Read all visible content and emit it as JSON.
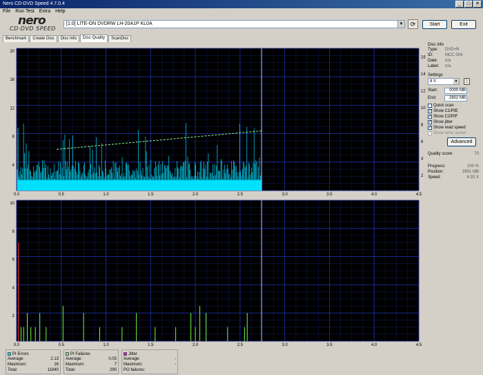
{
  "window": {
    "title": "Nero CD-DVD Speed 4.7.0.4"
  },
  "menu": [
    "File",
    "Run Test",
    "Extra",
    "Help"
  ],
  "logo": {
    "brand": "nero",
    "product": "CD·DVD SPEED"
  },
  "drive": {
    "label": "[1:0]  LITE-ON DVDRW LH-20A1P KL0A"
  },
  "buttons": {
    "start": "Start",
    "exit": "Exit",
    "advanced": "Advanced"
  },
  "tabs": [
    "Benchmark",
    "Create Disc",
    "Disc Info",
    "Disc Quality",
    "ScanDisc"
  ],
  "active_tab": "Disc Quality",
  "disc_info": {
    "header": "Disc info",
    "rows": [
      {
        "k": "Type:",
        "v": "DVD+R"
      },
      {
        "k": "ID:",
        "v": "MCC 004"
      },
      {
        "k": "Date:",
        "v": "n/a"
      },
      {
        "k": "Label:",
        "v": "n/a"
      }
    ]
  },
  "settings": {
    "header": "Settings",
    "speed": "8 X",
    "start_label": "Start:",
    "start_value": "0000 MB",
    "end_label": "End:",
    "end_value": "2802 MB",
    "checks": [
      {
        "label": "Quick scan",
        "checked": false,
        "disabled": false
      },
      {
        "label": "Show C1/PIE",
        "checked": true,
        "disabled": false
      },
      {
        "label": "Show C2/PIF",
        "checked": true,
        "disabled": false
      },
      {
        "label": "Show jitter",
        "checked": true,
        "disabled": false
      },
      {
        "label": "Show read speed",
        "checked": true,
        "disabled": false
      },
      {
        "label": "Show write speed",
        "checked": true,
        "disabled": true
      }
    ]
  },
  "quality_score": {
    "label": "Quality score:",
    "value": "70"
  },
  "progress": {
    "rows": [
      {
        "k": "Progress:",
        "v": "100 %"
      },
      {
        "k": "Position:",
        "v": "2801 MB"
      },
      {
        "k": "Speed:",
        "v": "6.93 X"
      }
    ]
  },
  "stats": {
    "pi_errors": {
      "title": "PI Errors",
      "color": "#00e0ff",
      "rows": [
        {
          "k": "Average:",
          "v": "2.13"
        },
        {
          "k": "Maximum:",
          "v": "16"
        },
        {
          "k": "Total:",
          "v": "11840"
        }
      ]
    },
    "pi_failures": {
      "title": "PI Failures",
      "color": "#80e080",
      "rows": [
        {
          "k": "Average:",
          "v": "0.03"
        },
        {
          "k": "Maximum:",
          "v": "7"
        },
        {
          "k": "Total:",
          "v": "290"
        }
      ]
    },
    "jitter": {
      "title": "Jitter",
      "color": "#e000e0",
      "rows": [
        {
          "k": "Average:",
          "v": "-"
        },
        {
          "k": "Maximum:",
          "v": "-"
        }
      ],
      "extra": "PO failures:"
    }
  },
  "chart_data": [
    {
      "type": "bar",
      "title": "",
      "x_ticks": [
        "0.0",
        "0.5",
        "1.0",
        "1.5",
        "2.0",
        "2.5",
        "3.0",
        "3.5",
        "4.0",
        "4.5"
      ],
      "y_left_ticks": [
        "20",
        "16",
        "12",
        "8",
        "4"
      ],
      "y_right_ticks": [
        "16",
        "14",
        "12",
        "10",
        "8",
        "6",
        "4",
        "2"
      ],
      "xlim": [
        0,
        4.5
      ],
      "ylim": [
        0,
        20
      ],
      "scan_end": 2.74,
      "series": [
        {
          "name": "PI Errors",
          "color": "#00e0ff",
          "avg": 2.13,
          "max": 16
        },
        {
          "name": "Read speed",
          "color": "#90ff90",
          "start": 5.8,
          "end": 8.4
        }
      ]
    },
    {
      "type": "bar",
      "x_ticks": [
        "0.0",
        "0.5",
        "1.0",
        "1.5",
        "2.0",
        "2.5",
        "3.0",
        "3.5",
        "4.0",
        "4.5"
      ],
      "y_left_ticks": [
        "10",
        "8",
        "6",
        "4",
        "2"
      ],
      "xlim": [
        0,
        4.5
      ],
      "ylim": [
        0,
        10
      ],
      "scan_end": 2.74,
      "series": [
        {
          "name": "PI Failures",
          "color": "#70ff40",
          "avg": 0.03,
          "max": 7
        }
      ]
    }
  ]
}
